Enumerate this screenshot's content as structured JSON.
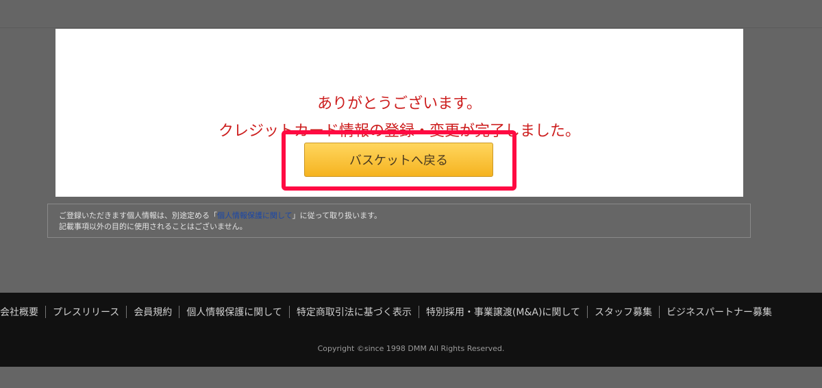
{
  "modal": {
    "message_line1": "ありがとうございます。",
    "message_line2": "クレジットカード情報の登録・変更が完了しました。",
    "button_label": "バスケットへ戻る"
  },
  "notice": {
    "line1_prefix": "ご登録いただきます個人情報は、別途定める「",
    "line1_link": "個人情報保護に関して",
    "line1_suffix": "」に従って取り扱います。",
    "line2": "記載事項以外の目的に使用されることはございません。"
  },
  "footer": {
    "links": [
      "会社概要",
      "プレスリリース",
      "会員規約",
      "個人情報保護に関して",
      "特定商取引法に基づく表示",
      "特別採用・事業譲渡(M&A)に関して",
      "スタッフ募集",
      "ビジネスパートナー募集"
    ],
    "copyright": "Copyright ©since 1998 DMM All Rights Reserved."
  },
  "colors": {
    "message": "#cc1d1d",
    "highlight_border": "#ff0a42",
    "button_gradient_top": "#ffd65e",
    "button_gradient_bottom": "#f5b320"
  }
}
